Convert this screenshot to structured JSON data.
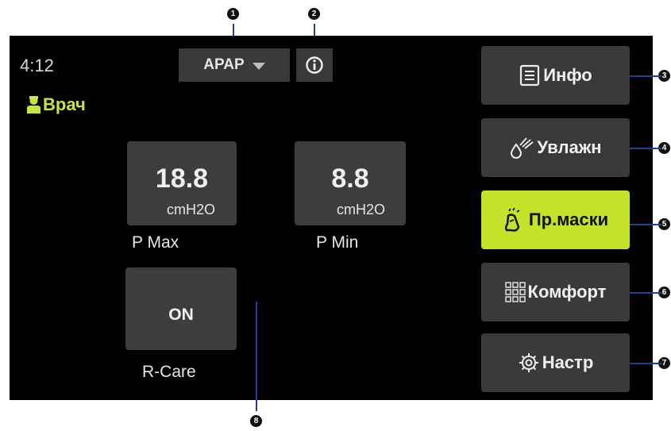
{
  "status": {
    "time": "4:12",
    "user_label": "Врач"
  },
  "mode_selector": {
    "value": "APAP"
  },
  "tiles": {
    "pmax": {
      "value": "18.8",
      "unit": "cmH2O",
      "label": "P Max"
    },
    "pmin": {
      "value": "8.8",
      "unit": "cmH2O",
      "label": "P Min"
    },
    "rcare": {
      "value": "ON",
      "label": "R-Care"
    }
  },
  "menu": [
    {
      "label": "Инфо",
      "icon": "document-icon",
      "active": false
    },
    {
      "label": "Увлажн",
      "icon": "humidifier-icon",
      "active": false
    },
    {
      "label": "Пр.маски",
      "icon": "mask-fit-icon",
      "active": true
    },
    {
      "label": "Комфорт",
      "icon": "grid-icon",
      "active": false
    },
    {
      "label": "Настр",
      "icon": "gear-icon",
      "active": false
    }
  ],
  "callouts": [
    "1",
    "2",
    "3",
    "4",
    "5",
    "6",
    "7",
    "8"
  ],
  "colors": {
    "accent": "#c6e12a",
    "tile": "#3d3d3d",
    "screen": "#000000",
    "leader": "#1f3f99"
  }
}
